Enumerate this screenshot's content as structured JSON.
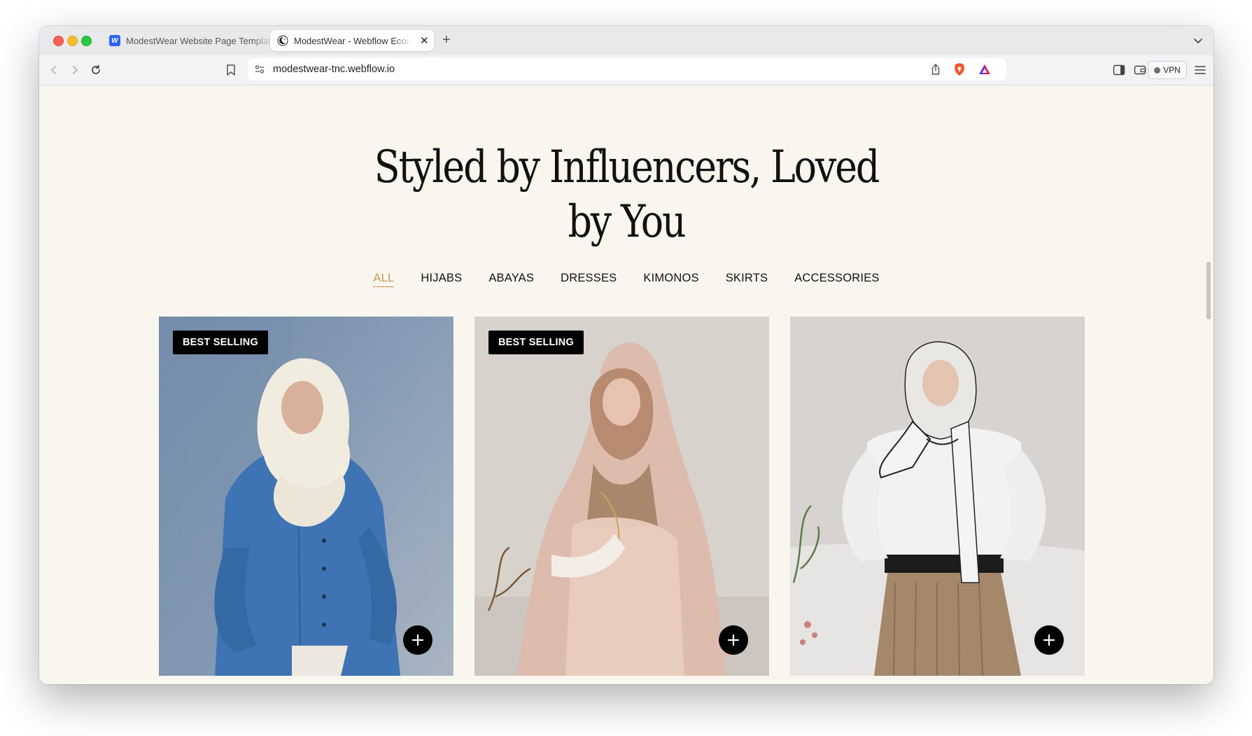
{
  "browser": {
    "tabs": [
      {
        "title": "ModestWear Website Page Templates",
        "favicon": "webflow-icon"
      },
      {
        "title": "ModestWear - Webflow Ecommerce",
        "favicon": "modestwear-icon",
        "active": true
      }
    ],
    "url": "modestwear-tnc.webflow.io",
    "vpn_label": "VPN"
  },
  "page": {
    "headline_line1": "Styled by Influencers, Loved",
    "headline_line2": "by You",
    "filters": [
      "ALL",
      "HIJABS",
      "ABAYAS",
      "DRESSES",
      "KIMONOS",
      "SKIRTS",
      "ACCESSORIES"
    ],
    "active_filter": "ALL",
    "products": [
      {
        "badge": "BEST SELLING",
        "image": "woman in blue linen shirt and cream hijab"
      },
      {
        "badge": "BEST SELLING",
        "image": "woman in blush pink hijab and sheer abaya"
      },
      {
        "badge": "",
        "image": "woman in white blouse, printed scarf and pleated skirt"
      }
    ]
  },
  "colors": {
    "page_bg": "#f9f6ef",
    "accent": "#c9955d",
    "badge_bg": "#000000"
  }
}
